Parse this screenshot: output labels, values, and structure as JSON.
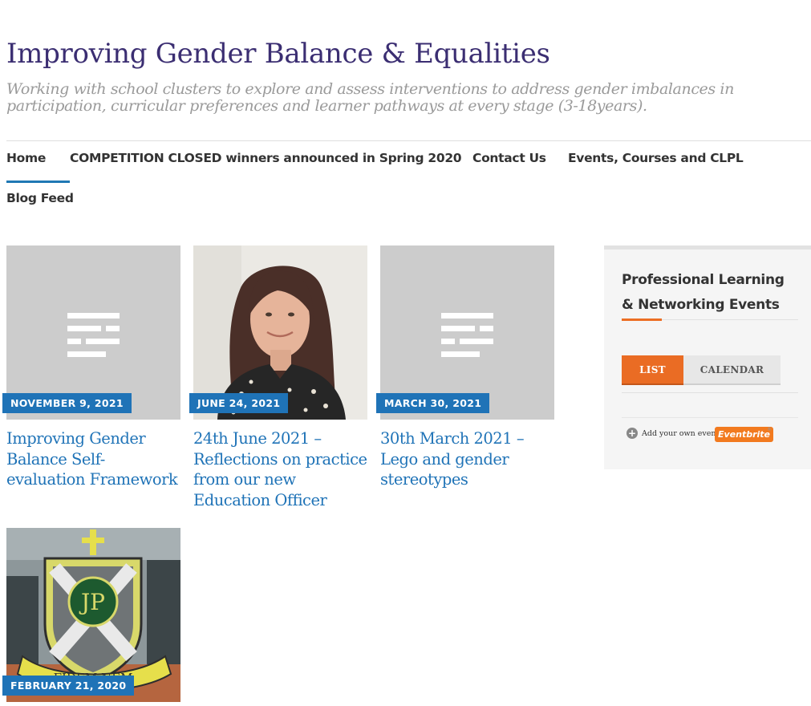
{
  "site": {
    "title": "Improving Gender Balance & Equalities",
    "description": "Working with school clusters to explore and assess interventions to address gender imbalances in participation, curricular preferences and learner pathways at every stage (3-18years)."
  },
  "nav": {
    "items": [
      {
        "label": "Home",
        "active": true
      },
      {
        "label": "COMPETITION CLOSED winners announced in Spring 2020"
      },
      {
        "label": "Contact Us"
      },
      {
        "label": "Events, Courses and CLPL"
      },
      {
        "label": "Blog Feed"
      }
    ]
  },
  "posts": [
    {
      "date": "NOVEMBER 9, 2021",
      "title": "Improving Gender Balance Self-evaluation Framework",
      "thumbnail": "document-placeholder-icon"
    },
    {
      "date": "JUNE 24, 2021",
      "title": "24th June 2021 – Reflections on practice from our new Education Officer",
      "thumbnail": "portrait-photo"
    },
    {
      "date": "MARCH 30, 2021",
      "title": "30th March 2021 – Lego and gender stereotypes",
      "thumbnail": "document-placeholder-icon"
    },
    {
      "date": "FEBRUARY 21, 2020",
      "title": "",
      "thumbnail": "school-crest-photo"
    }
  ],
  "widget": {
    "title": "Professional Learning & Networking Events",
    "tabs": [
      "LIST",
      "CALENDAR"
    ],
    "add_event_label": "Add your own event",
    "eventbrite_logo": "Eventbrite",
    "eventbrite_registered": "®"
  },
  "colors": {
    "title": "#3b2e72",
    "accent_blue": "#1f73b7",
    "accent_orange": "#ea6c24",
    "placeholder_gray": "#cccccc"
  }
}
